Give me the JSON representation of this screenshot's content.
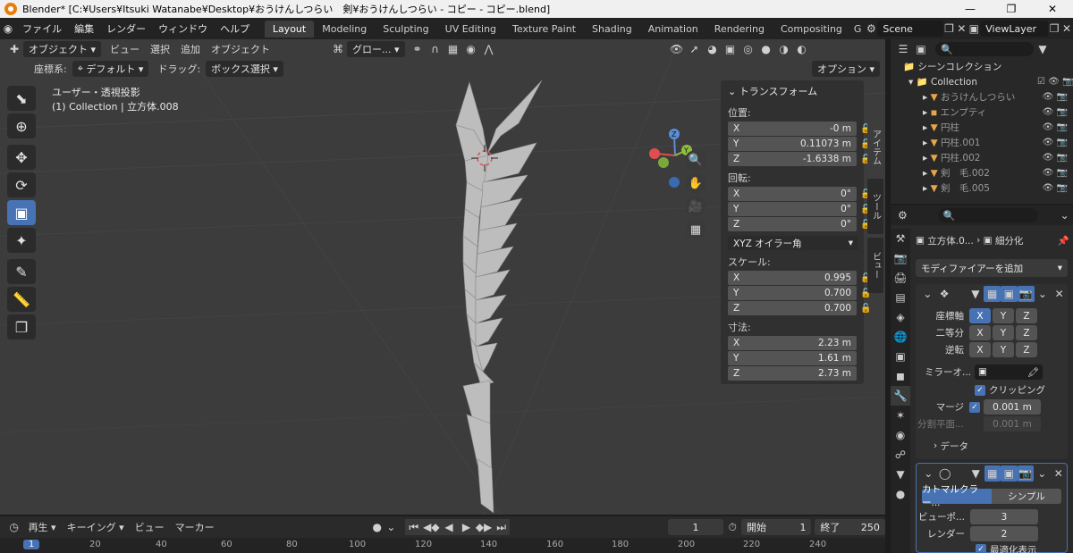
{
  "title_bar": {
    "title": "Blender* [C:¥Users¥Itsuki Watanabe¥Desktop¥おうけんしつらい　剣¥おうけんしつらい - コピー - コピー.blend]"
  },
  "menu": {
    "items": [
      "ファイル",
      "編集",
      "レンダー",
      "ウィンドウ",
      "ヘルプ"
    ]
  },
  "workspaces": [
    "Layout",
    "Modeling",
    "Sculpting",
    "UV Editing",
    "Texture Paint",
    "Shading",
    "Animation",
    "Rendering",
    "Compositing",
    "G"
  ],
  "scene": {
    "name": "Scene",
    "view_layer": "ViewLayer"
  },
  "viewport_header": {
    "mode": "オブジェクト",
    "view": "ビュー",
    "select": "選択",
    "add": "追加",
    "object": "オブジェクト",
    "transform_orientation": "グロー...",
    "coord_label": "座標系:",
    "coord_value": "デフォルト",
    "drag_label": "ドラッグ:",
    "drag_value": "ボックス選択",
    "options": "オプション"
  },
  "viewport_info": {
    "line1": "ユーザー・透視投影",
    "line2": "(1) Collection | 立方体.008"
  },
  "transform_panel": {
    "title": "トランスフォーム",
    "location_label": "位置:",
    "location": [
      {
        "axis": "X",
        "value": "-0 m"
      },
      {
        "axis": "Y",
        "value": "0.11073 m"
      },
      {
        "axis": "Z",
        "value": "-1.6338 m"
      }
    ],
    "rotation_label": "回転:",
    "rotation": [
      {
        "axis": "X",
        "value": "0°"
      },
      {
        "axis": "Y",
        "value": "0°"
      },
      {
        "axis": "Z",
        "value": "0°"
      }
    ],
    "rotation_mode": "XYZ オイラー角",
    "scale_label": "スケール:",
    "scale": [
      {
        "axis": "X",
        "value": "0.995"
      },
      {
        "axis": "Y",
        "value": "0.700"
      },
      {
        "axis": "Z",
        "value": "0.700"
      }
    ],
    "dimensions_label": "寸法:",
    "dimensions": [
      {
        "axis": "X",
        "value": "2.23 m"
      },
      {
        "axis": "Y",
        "value": "1.61 m"
      },
      {
        "axis": "Z",
        "value": "2.73 m"
      }
    ]
  },
  "side_tabs": [
    "アイテム",
    "ツール",
    "ビュー"
  ],
  "gizmo": {
    "x": "X",
    "y": "Y",
    "z": "Z"
  },
  "outliner": {
    "root": "シーンコレクション",
    "collection": "Collection",
    "items": [
      "おうけんしつらい",
      "エンプティ",
      "円柱",
      "円柱.001",
      "円柱.002",
      "剣　毛.002",
      "剣　毛.005"
    ]
  },
  "properties": {
    "object_name": "立方体.0...",
    "modifier_name": "細分化",
    "add_modifier": "モディファイアーを追加",
    "mirror": {
      "axis_label": "座標軸",
      "bisect_label": "二等分",
      "flip_label": "逆転",
      "axes": [
        "X",
        "Y",
        "Z"
      ],
      "mirror_object_label": "ミラーオ...",
      "clipping_label": "クリッピング",
      "merge_label": "マージ",
      "merge_value": "0.001 m",
      "bisect_distance_label": "分割平面...",
      "bisect_distance_value": "0.001 m",
      "data_label": "データ"
    },
    "subsurf": {
      "catmull": "カトマルクラー...",
      "simple": "シンプル",
      "viewport_label": "ビューポ...",
      "viewport_value": "3",
      "render_label": "レンダー",
      "render_value": "2",
      "optimal_label": "最適化表示"
    }
  },
  "timeline": {
    "playback": "再生",
    "keying": "キーイング",
    "view": "ビュー",
    "marker": "マーカー",
    "current_frame": "1",
    "start_label": "開始",
    "start_value": "1",
    "end_label": "終了",
    "end_value": "250",
    "ticks": [
      "1",
      "20",
      "40",
      "60",
      "80",
      "100",
      "120",
      "140",
      "160",
      "180",
      "200",
      "220",
      "240"
    ]
  }
}
